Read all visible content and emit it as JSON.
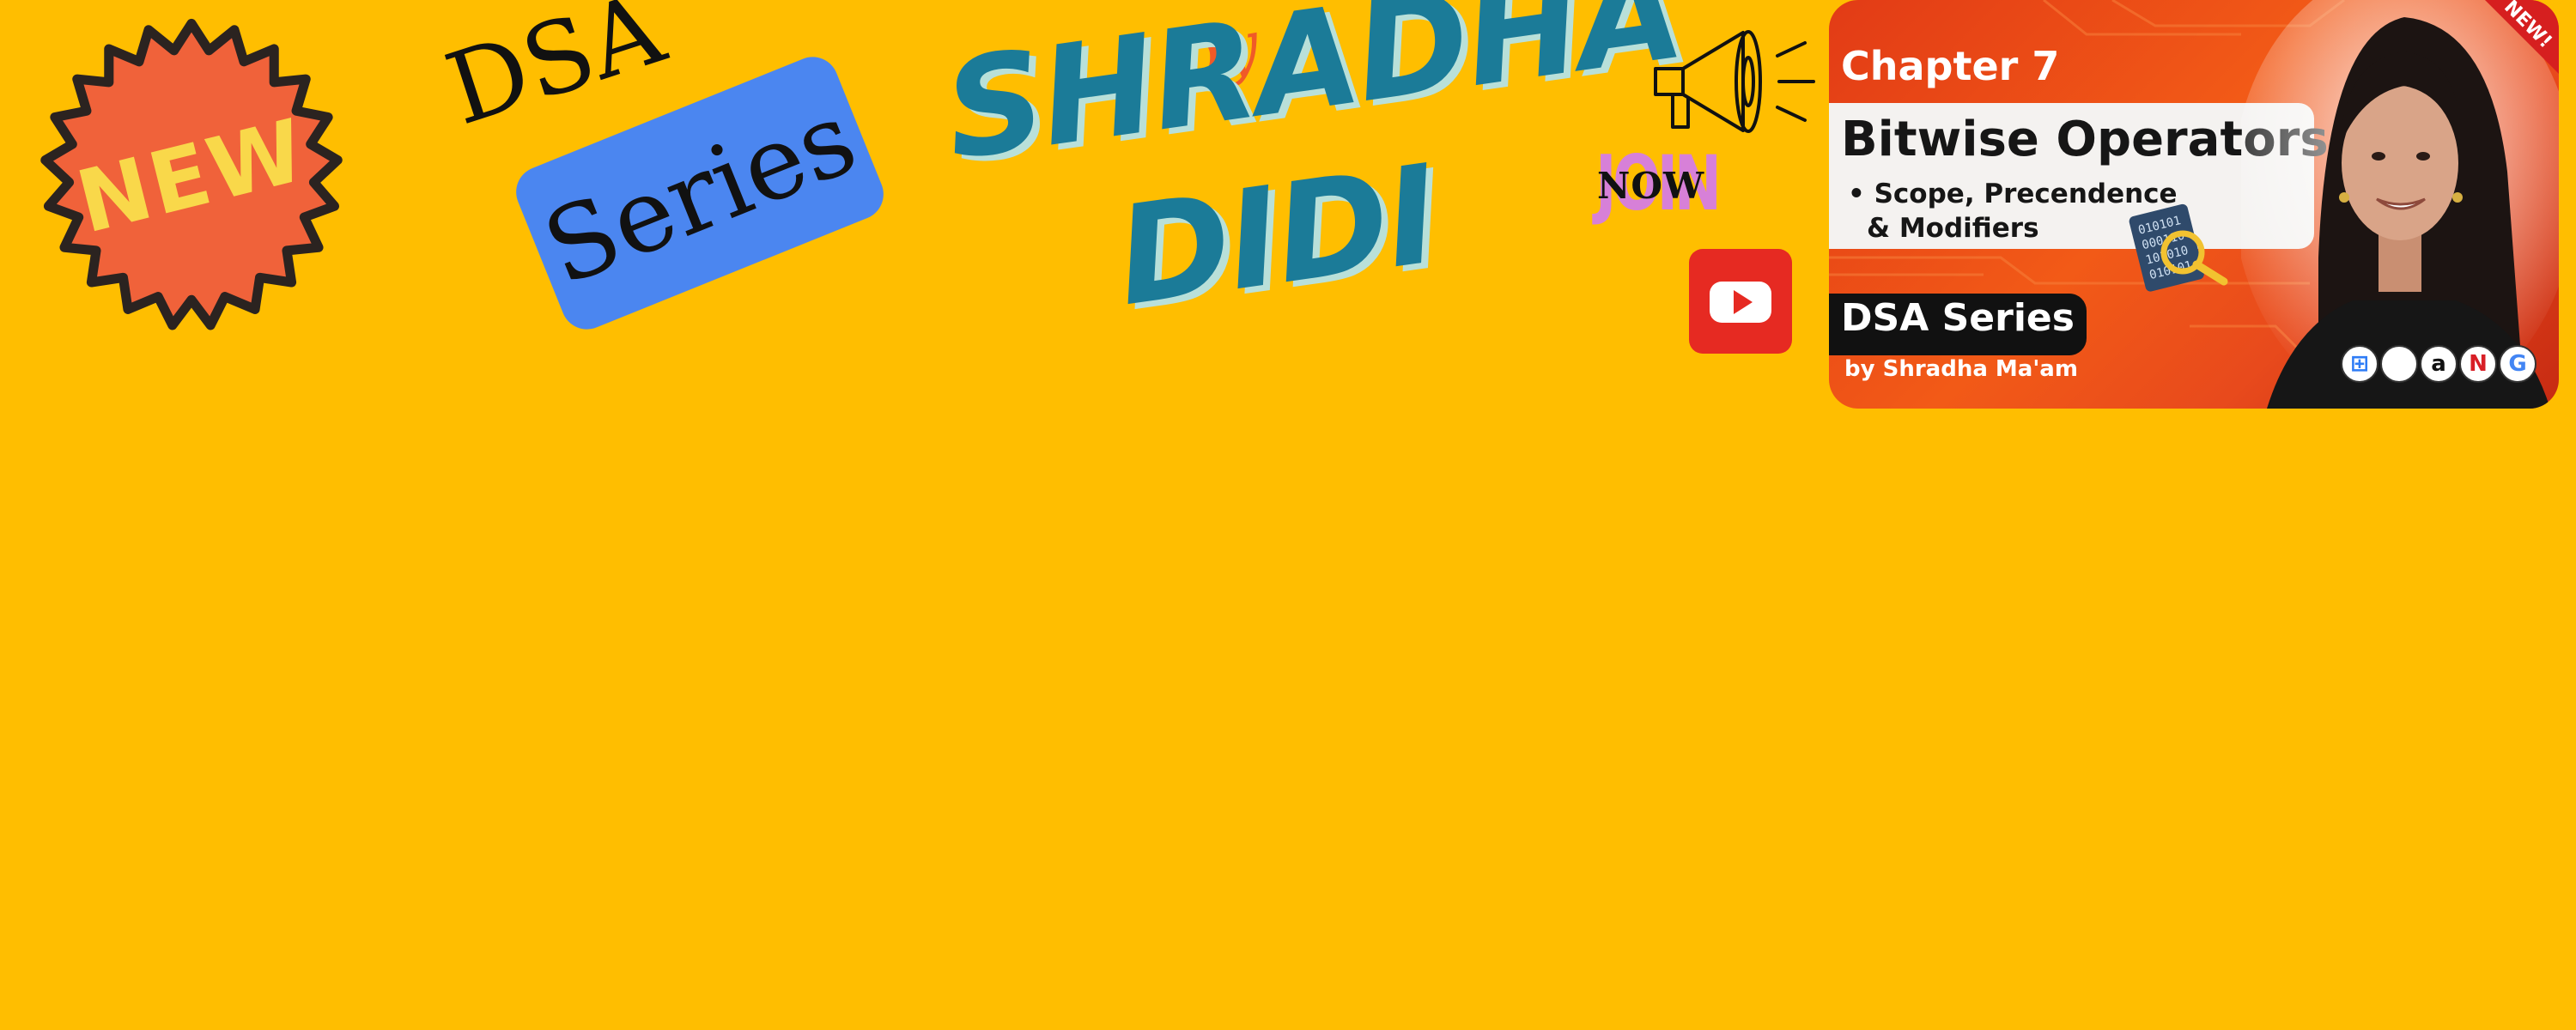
{
  "badge": {
    "text": "NEW"
  },
  "dsa": {
    "text": "DSA"
  },
  "series_tag": {
    "text": "Series"
  },
  "author": {
    "by": "by",
    "first": "SHRADHA",
    "second": "DIDI"
  },
  "join": {
    "join": "JOIN",
    "now": "NOW"
  },
  "icons": {
    "megaphone": "megaphone-icon",
    "youtube": "youtube-icon",
    "binary": "binary-magnifier-icon"
  },
  "thumbnail": {
    "chapter": "Chapter 7",
    "title": "Bitwise Operators",
    "bullet_line1": "• Scope, Precendence",
    "bullet_line2": "& Modifiers",
    "series": "DSA Series",
    "byline": "by Shradha Ma'am",
    "corner": "NEW!",
    "logos": [
      "⊞",
      "",
      "a",
      "N",
      "G"
    ]
  },
  "colors": {
    "background": "#FFBE00",
    "badge": "#F0623A",
    "badge_text": "#F9D84A",
    "series_box": "#4B86F0",
    "name": "#1B7B98",
    "name_shadow": "#B9E0D9",
    "by": "#F05A28",
    "join": "#D780D8",
    "youtube": "#E62A22"
  }
}
